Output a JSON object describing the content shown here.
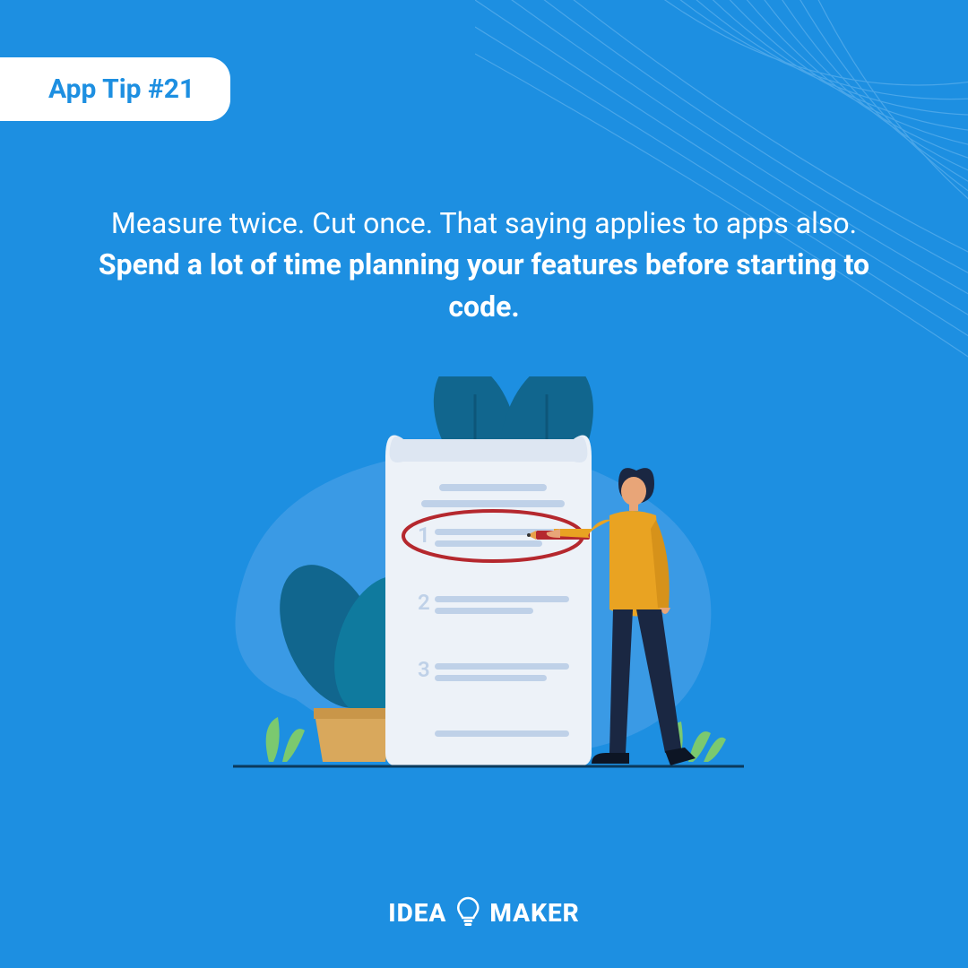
{
  "badge": {
    "label": "App Tip #21"
  },
  "heading": {
    "prefix": "Measure twice. Cut once. That saying applies to apps also. ",
    "bold": "Spend a lot of time planning your features before starting to code."
  },
  "logo": {
    "left": "IDEA",
    "right": "MAKER"
  },
  "colors": {
    "background": "#1d8fe1",
    "badgeBackground": "#ffffff",
    "badgeText": "#1d8fe1",
    "textOnBlue": "#ffffff"
  }
}
